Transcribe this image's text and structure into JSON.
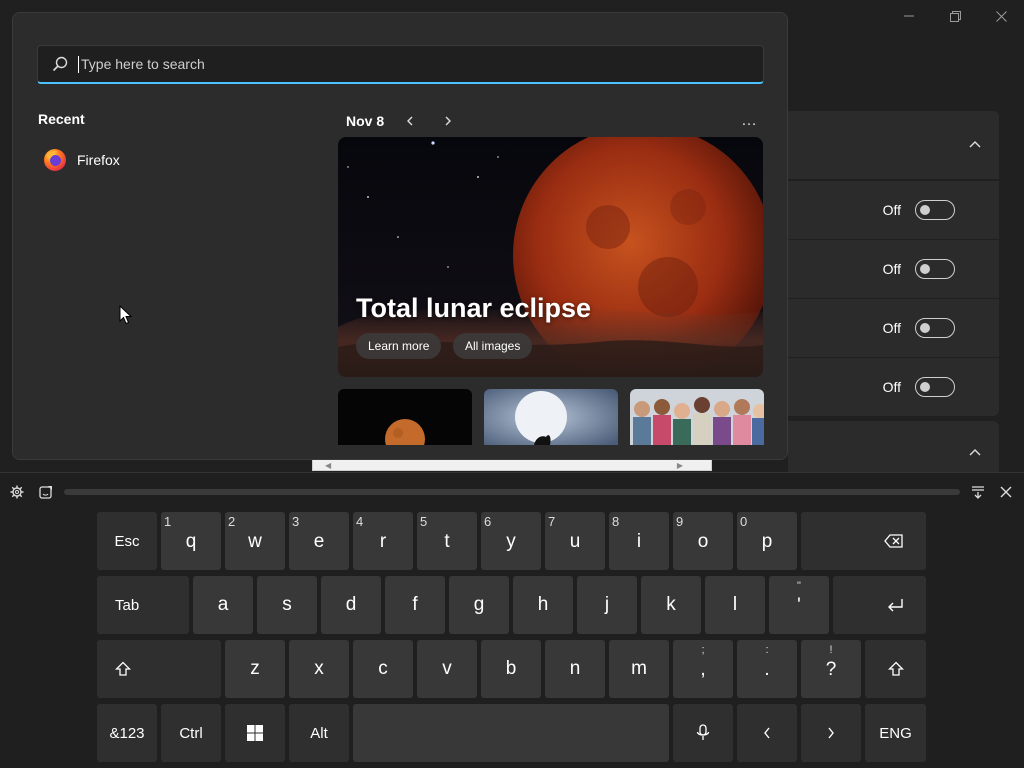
{
  "settings": {
    "toggle_rows": [
      {
        "state": "Off"
      },
      {
        "state": "Off"
      },
      {
        "state": "Off"
      },
      {
        "state": "Off"
      }
    ]
  },
  "search": {
    "placeholder": "Type here to search",
    "value": ""
  },
  "recent": {
    "title": "Recent",
    "items": [
      {
        "label": "Firefox",
        "icon": "firefox-icon"
      }
    ]
  },
  "spotlight": {
    "date": "Nov 8",
    "hero_title": "Total lunar eclipse",
    "learn_more": "Learn more",
    "all_images": "All images",
    "more": "…"
  },
  "keyboard": {
    "rows": [
      [
        {
          "label": "Esc"
        },
        {
          "label": "q",
          "num": "1"
        },
        {
          "label": "w",
          "num": "2"
        },
        {
          "label": "e",
          "num": "3"
        },
        {
          "label": "r",
          "num": "4"
        },
        {
          "label": "t",
          "num": "5"
        },
        {
          "label": "y",
          "num": "6"
        },
        {
          "label": "u",
          "num": "7"
        },
        {
          "label": "i",
          "num": "8"
        },
        {
          "label": "o",
          "num": "9"
        },
        {
          "label": "p",
          "num": "0"
        }
      ],
      [
        {
          "label": "Tab"
        },
        {
          "label": "a"
        },
        {
          "label": "s"
        },
        {
          "label": "d"
        },
        {
          "label": "f"
        },
        {
          "label": "g"
        },
        {
          "label": "h"
        },
        {
          "label": "j"
        },
        {
          "label": "k"
        },
        {
          "label": "l"
        },
        {
          "label": "'",
          "alt": "\""
        }
      ],
      [
        {
          "label": "z"
        },
        {
          "label": "x"
        },
        {
          "label": "c"
        },
        {
          "label": "v"
        },
        {
          "label": "b"
        },
        {
          "label": "n"
        },
        {
          "label": "m"
        },
        {
          "label": ",",
          "alt": ";"
        },
        {
          "label": ".",
          "alt": ":"
        },
        {
          "label": "?",
          "alt": "!"
        }
      ],
      [
        {
          "label": "&123"
        },
        {
          "label": "Ctrl"
        },
        {
          "label": "Alt"
        },
        {
          "label": "ENG"
        }
      ]
    ]
  },
  "colors": {
    "accent": "#4cc2ff",
    "background": "#202020",
    "key": "#383838"
  }
}
